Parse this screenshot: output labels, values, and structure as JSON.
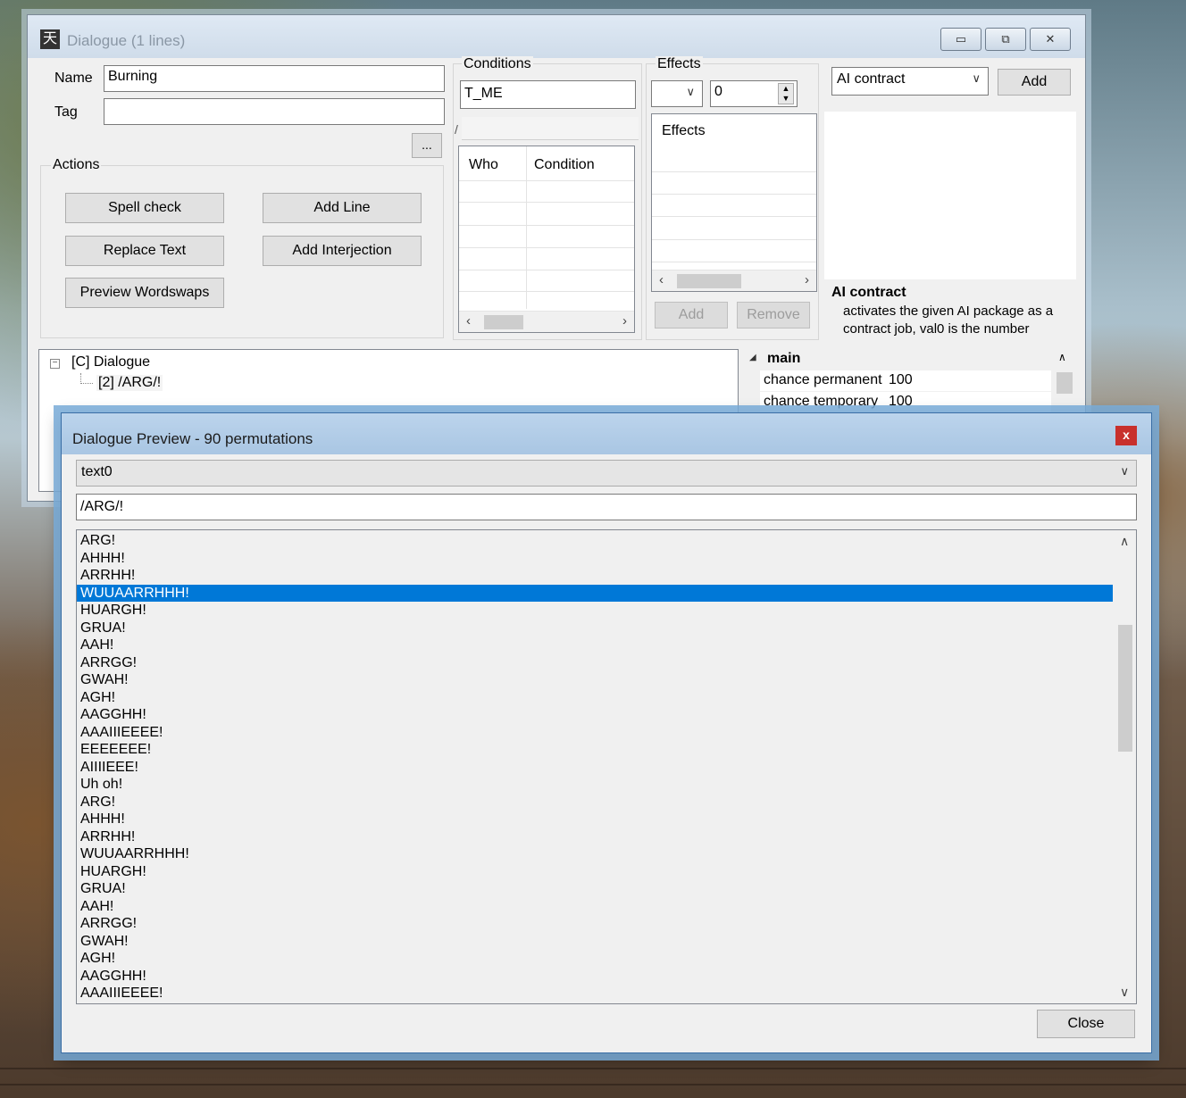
{
  "main_window": {
    "title": "Dialogue (1 lines)",
    "app_icon_glyph": "天",
    "caption_buttons": {
      "minimize": "▭",
      "restore": "⧉",
      "close": "✕"
    },
    "name_label": "Name",
    "name_value": "Burning",
    "tag_label": "Tag",
    "tag_value": "",
    "ellipsis_label": "...",
    "actions_label": "Actions",
    "actions": {
      "spell_check": "Spell check",
      "add_line": "Add Line",
      "replace_text": "Replace Text",
      "add_interjection": "Add Interjection",
      "preview_wordswaps": "Preview Wordswaps"
    },
    "conditions": {
      "label": "Conditions",
      "value": "T_ME",
      "tab_fragment": "/",
      "columns": [
        "Who",
        "Condition"
      ]
    },
    "effects": {
      "label": "Effects",
      "dropdown_value": "",
      "number_value": "0",
      "list_header": "Effects",
      "add_label": "Add",
      "remove_label": "Remove"
    },
    "ai_contract": {
      "dropdown_value": "AI contract",
      "add_label": "Add",
      "heading": "AI contract",
      "description": "activates the given AI package as a contract job, val0 is the number"
    },
    "tree": {
      "root": "[C] Dialogue",
      "child": "[2] /ARG/!"
    },
    "properties": {
      "section": "main",
      "rows": [
        {
          "name": "chance permanent",
          "value": "100"
        },
        {
          "name": "chance temporary",
          "value": "100"
        }
      ]
    }
  },
  "preview_window": {
    "title": "Dialogue Preview - 90 permutations",
    "close_x": "x",
    "selector_value": "text0",
    "pattern_value": "/ARG/!",
    "selected_index": 3,
    "items": [
      "ARG!",
      "AHHH!",
      "ARRHH!",
      "WUUAARRHHH!",
      "HUARGH!",
      "GRUA!",
      "AAH!",
      "ARRGG!",
      "GWAH!",
      "AGH!",
      "AAGGHH!",
      "AAAIIIEEEE!",
      "EEEEEEE!",
      "AIIIIEEE!",
      "Uh oh!",
      "ARG!",
      "AHHH!",
      "ARRHH!",
      "WUUAARRHHH!",
      "HUARGH!",
      "GRUA!",
      "AAH!",
      "ARRGG!",
      "GWAH!",
      "AGH!",
      "AAGGHH!",
      "AAAIIIEEEE!"
    ],
    "close_button": "Close"
  }
}
